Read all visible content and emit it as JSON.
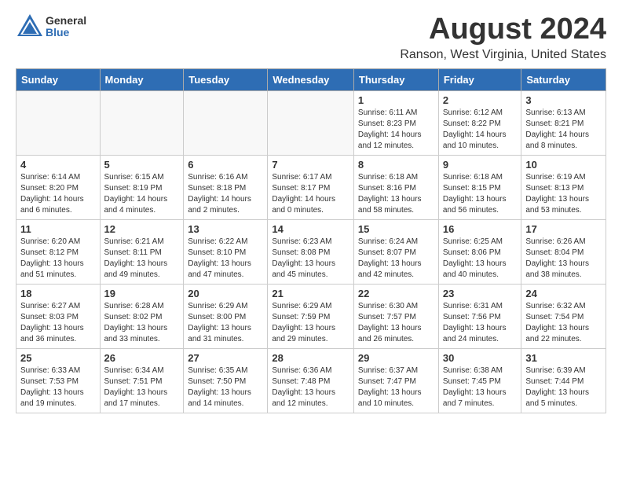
{
  "logo": {
    "general": "General",
    "blue": "Blue"
  },
  "title": "August 2024",
  "location": "Ranson, West Virginia, United States",
  "days_of_week": [
    "Sunday",
    "Monday",
    "Tuesday",
    "Wednesday",
    "Thursday",
    "Friday",
    "Saturday"
  ],
  "weeks": [
    [
      {
        "day": "",
        "info": ""
      },
      {
        "day": "",
        "info": ""
      },
      {
        "day": "",
        "info": ""
      },
      {
        "day": "",
        "info": ""
      },
      {
        "day": "1",
        "info": "Sunrise: 6:11 AM\nSunset: 8:23 PM\nDaylight: 14 hours\nand 12 minutes."
      },
      {
        "day": "2",
        "info": "Sunrise: 6:12 AM\nSunset: 8:22 PM\nDaylight: 14 hours\nand 10 minutes."
      },
      {
        "day": "3",
        "info": "Sunrise: 6:13 AM\nSunset: 8:21 PM\nDaylight: 14 hours\nand 8 minutes."
      }
    ],
    [
      {
        "day": "4",
        "info": "Sunrise: 6:14 AM\nSunset: 8:20 PM\nDaylight: 14 hours\nand 6 minutes."
      },
      {
        "day": "5",
        "info": "Sunrise: 6:15 AM\nSunset: 8:19 PM\nDaylight: 14 hours\nand 4 minutes."
      },
      {
        "day": "6",
        "info": "Sunrise: 6:16 AM\nSunset: 8:18 PM\nDaylight: 14 hours\nand 2 minutes."
      },
      {
        "day": "7",
        "info": "Sunrise: 6:17 AM\nSunset: 8:17 PM\nDaylight: 14 hours\nand 0 minutes."
      },
      {
        "day": "8",
        "info": "Sunrise: 6:18 AM\nSunset: 8:16 PM\nDaylight: 13 hours\nand 58 minutes."
      },
      {
        "day": "9",
        "info": "Sunrise: 6:18 AM\nSunset: 8:15 PM\nDaylight: 13 hours\nand 56 minutes."
      },
      {
        "day": "10",
        "info": "Sunrise: 6:19 AM\nSunset: 8:13 PM\nDaylight: 13 hours\nand 53 minutes."
      }
    ],
    [
      {
        "day": "11",
        "info": "Sunrise: 6:20 AM\nSunset: 8:12 PM\nDaylight: 13 hours\nand 51 minutes."
      },
      {
        "day": "12",
        "info": "Sunrise: 6:21 AM\nSunset: 8:11 PM\nDaylight: 13 hours\nand 49 minutes."
      },
      {
        "day": "13",
        "info": "Sunrise: 6:22 AM\nSunset: 8:10 PM\nDaylight: 13 hours\nand 47 minutes."
      },
      {
        "day": "14",
        "info": "Sunrise: 6:23 AM\nSunset: 8:08 PM\nDaylight: 13 hours\nand 45 minutes."
      },
      {
        "day": "15",
        "info": "Sunrise: 6:24 AM\nSunset: 8:07 PM\nDaylight: 13 hours\nand 42 minutes."
      },
      {
        "day": "16",
        "info": "Sunrise: 6:25 AM\nSunset: 8:06 PM\nDaylight: 13 hours\nand 40 minutes."
      },
      {
        "day": "17",
        "info": "Sunrise: 6:26 AM\nSunset: 8:04 PM\nDaylight: 13 hours\nand 38 minutes."
      }
    ],
    [
      {
        "day": "18",
        "info": "Sunrise: 6:27 AM\nSunset: 8:03 PM\nDaylight: 13 hours\nand 36 minutes."
      },
      {
        "day": "19",
        "info": "Sunrise: 6:28 AM\nSunset: 8:02 PM\nDaylight: 13 hours\nand 33 minutes."
      },
      {
        "day": "20",
        "info": "Sunrise: 6:29 AM\nSunset: 8:00 PM\nDaylight: 13 hours\nand 31 minutes."
      },
      {
        "day": "21",
        "info": "Sunrise: 6:29 AM\nSunset: 7:59 PM\nDaylight: 13 hours\nand 29 minutes."
      },
      {
        "day": "22",
        "info": "Sunrise: 6:30 AM\nSunset: 7:57 PM\nDaylight: 13 hours\nand 26 minutes."
      },
      {
        "day": "23",
        "info": "Sunrise: 6:31 AM\nSunset: 7:56 PM\nDaylight: 13 hours\nand 24 minutes."
      },
      {
        "day": "24",
        "info": "Sunrise: 6:32 AM\nSunset: 7:54 PM\nDaylight: 13 hours\nand 22 minutes."
      }
    ],
    [
      {
        "day": "25",
        "info": "Sunrise: 6:33 AM\nSunset: 7:53 PM\nDaylight: 13 hours\nand 19 minutes."
      },
      {
        "day": "26",
        "info": "Sunrise: 6:34 AM\nSunset: 7:51 PM\nDaylight: 13 hours\nand 17 minutes."
      },
      {
        "day": "27",
        "info": "Sunrise: 6:35 AM\nSunset: 7:50 PM\nDaylight: 13 hours\nand 14 minutes."
      },
      {
        "day": "28",
        "info": "Sunrise: 6:36 AM\nSunset: 7:48 PM\nDaylight: 13 hours\nand 12 minutes."
      },
      {
        "day": "29",
        "info": "Sunrise: 6:37 AM\nSunset: 7:47 PM\nDaylight: 13 hours\nand 10 minutes."
      },
      {
        "day": "30",
        "info": "Sunrise: 6:38 AM\nSunset: 7:45 PM\nDaylight: 13 hours\nand 7 minutes."
      },
      {
        "day": "31",
        "info": "Sunrise: 6:39 AM\nSunset: 7:44 PM\nDaylight: 13 hours\nand 5 minutes."
      }
    ]
  ]
}
